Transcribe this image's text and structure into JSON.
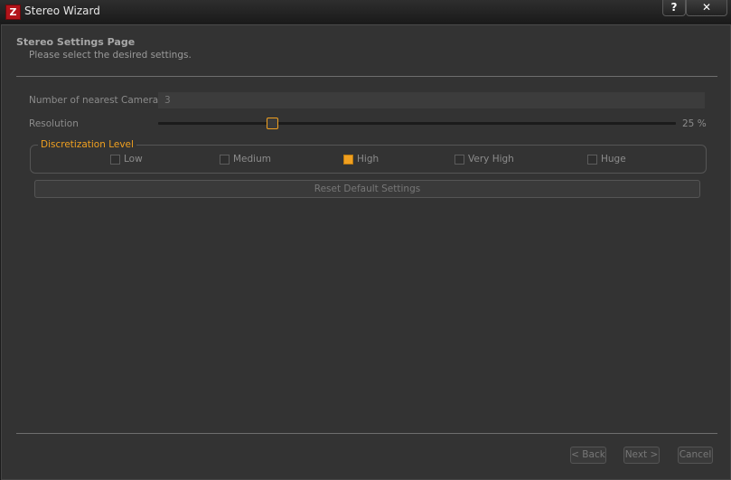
{
  "window": {
    "icon_letter": "Z",
    "title": "Stereo Wizard",
    "help_label": "?",
    "close_label": "✕"
  },
  "page": {
    "title": "Stereo Settings Page",
    "subtitle": "Please select the desired settings."
  },
  "settings": {
    "cameras_label": "Number of nearest Cameras",
    "cameras_value": "3",
    "resolution_label": "Resolution",
    "resolution_percent": 25,
    "resolution_display": "25 %"
  },
  "discretization": {
    "title": "Discretization Level",
    "options": [
      {
        "label": "Low",
        "checked": false
      },
      {
        "label": "Medium",
        "checked": false
      },
      {
        "label": "High",
        "checked": true
      },
      {
        "label": "Very High",
        "checked": false
      },
      {
        "label": "Huge",
        "checked": false
      }
    ]
  },
  "buttons": {
    "reset": "Reset Default Settings",
    "back": "< Back",
    "next": "Next >",
    "cancel": "Cancel"
  },
  "colors": {
    "accent": "#f0a020",
    "panel_bg": "#333333",
    "app_icon": "#b3141a"
  }
}
